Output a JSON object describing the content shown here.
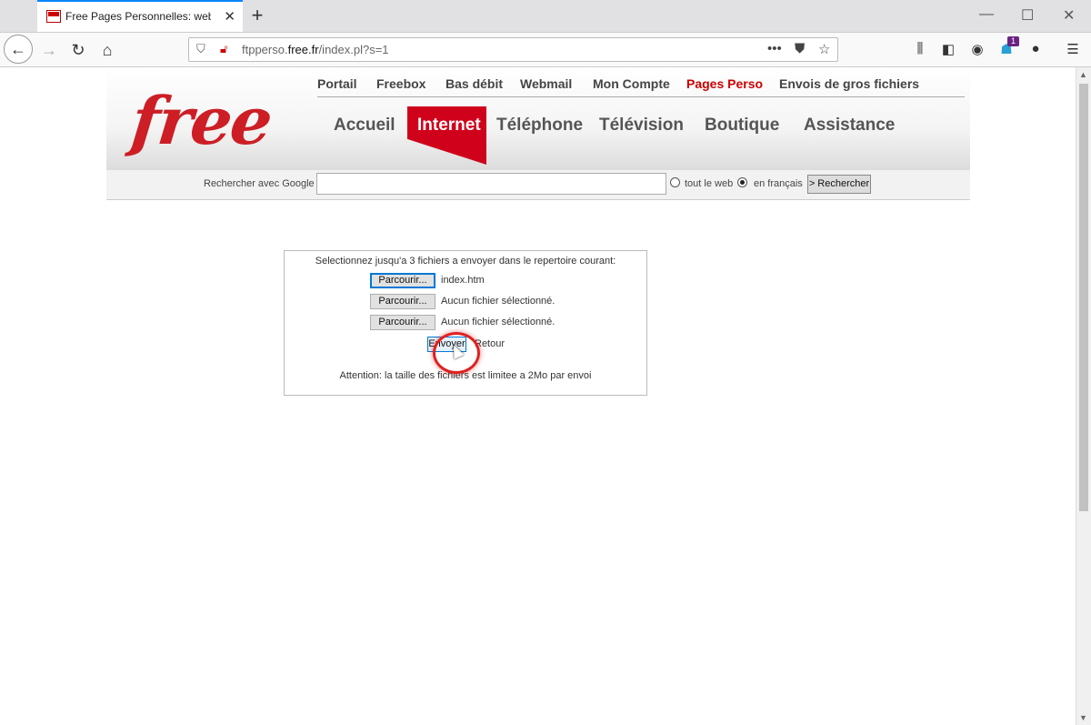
{
  "browser": {
    "tab_title": "Free Pages Personnelles: web f",
    "tab_close": "✕",
    "new_tab": "+",
    "url_prefix": "ftpperso.",
    "url_domain": "free.fr",
    "url_path": "/index.pl?s=1",
    "icons": [
      "back-icon",
      "forward-icon",
      "reload-icon",
      "home-icon",
      "shield-icon",
      "lock-icon",
      "more-icon",
      "pocket-icon",
      "star-icon",
      "library-icon",
      "sidebar-icon",
      "account-icon",
      "extension-icon",
      "extension2-icon",
      "menu-icon"
    ],
    "badge_count": "1"
  },
  "site": {
    "logo": "free",
    "top_nav": [
      "Portail",
      "Freebox",
      "Bas débit",
      "Webmail",
      "Mon Compte",
      "Pages Perso",
      "Envois de gros fichiers"
    ],
    "top_nav_active": "Pages Perso",
    "main_nav": [
      "Accueil",
      "Internet",
      "Téléphone",
      "Télévision",
      "Boutique",
      "Assistance"
    ],
    "main_nav_active": "Internet",
    "brand_color": "#cd1e25",
    "search": {
      "label": "Rechercher avec Google",
      "value": "",
      "option_web": "tout le web",
      "option_fr": "en français",
      "selected": "en français",
      "button": "> Rechercher"
    }
  },
  "form": {
    "hint": "Selectionnez jusqu'a 3 fichiers a envoyer dans le repertoire courant:",
    "browse_label": "Parcourir...",
    "files": [
      "index.htm",
      "Aucun fichier sélectionné.",
      "Aucun fichier sélectionné."
    ],
    "submit": "Envoyer",
    "back": "Retour",
    "warning": "Attention: la taille des fichiers est limitee a 2Mo par envoi"
  }
}
